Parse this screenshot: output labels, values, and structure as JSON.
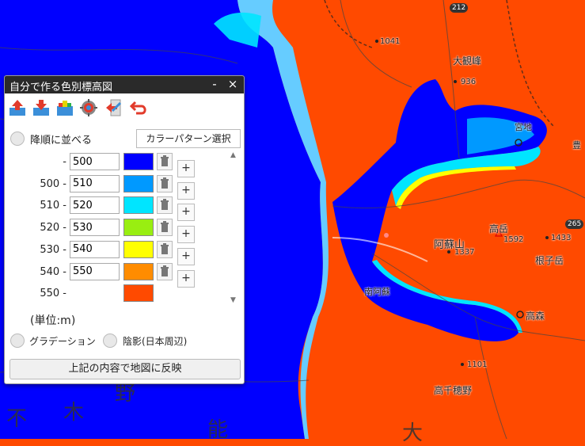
{
  "map": {
    "labels": {
      "taikanho": "大観峰",
      "h936": "936",
      "h1041": "1041",
      "takadake": "高岳",
      "h1592": "1592",
      "asosan": "阿蘇山",
      "h1337": "1337",
      "h1433": "1433",
      "nekodake": "根子岳",
      "takamori": "高森",
      "h1101": "1101",
      "takachiho": "高千穂野",
      "ooki": "大",
      "miyaji": "宮地",
      "yutaka": "豊",
      "minamiaso": "南阿蘇",
      "kanji1": "野",
      "kanji2": "木",
      "kanji3": "能",
      "kanji4": "不"
    },
    "routes": {
      "r212": "212",
      "r265": "265"
    },
    "colors": {
      "low": "#0000ff",
      "high": "#ff4a00"
    }
  },
  "panel": {
    "title": "自分で作る色別標高図",
    "minimize": "-",
    "close": "×",
    "toolbar_icons": [
      "upload-icon",
      "download-icon",
      "load-icon",
      "settings-icon",
      "export-icon",
      "undo-icon"
    ],
    "descending_label": "降順に並べる",
    "pattern_button": "カラーパターン選択",
    "rows": [
      {
        "lower": "",
        "sep": "-",
        "upper": "500",
        "color": "#0000ff",
        "has_controls": true
      },
      {
        "lower": "500",
        "sep": "-",
        "upper": "510",
        "color": "#0099ff",
        "has_controls": true
      },
      {
        "lower": "510",
        "sep": "-",
        "upper": "520",
        "color": "#00e5ff",
        "has_controls": true
      },
      {
        "lower": "520",
        "sep": "-",
        "upper": "530",
        "color": "#99ee11",
        "has_controls": true
      },
      {
        "lower": "530",
        "sep": "-",
        "upper": "540",
        "color": "#ffff00",
        "has_controls": true
      },
      {
        "lower": "540",
        "sep": "-",
        "upper": "550",
        "color": "#ff8c00",
        "has_controls": true
      },
      {
        "lower": "550",
        "sep": "-",
        "upper": "",
        "color": "#ff4a00",
        "has_controls": false
      }
    ],
    "plus": "+",
    "unit": "(単位:m)",
    "gradation_label": "グラデーション",
    "shade_label": "陰影(日本周辺)",
    "apply_button": "上記の内容で地図に反映"
  }
}
